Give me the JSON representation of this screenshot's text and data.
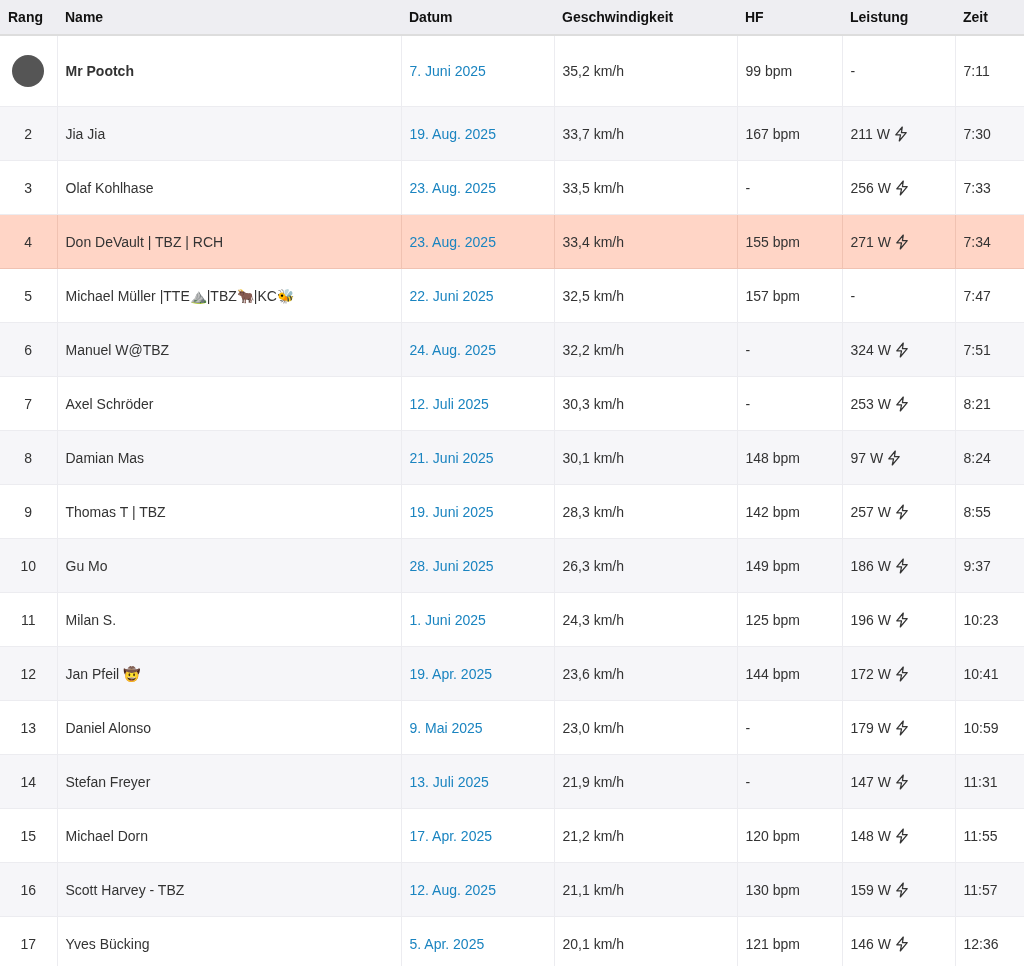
{
  "table": {
    "columns": [
      "Rang",
      "Name",
      "Datum",
      "Geschwindigkeit",
      "HF",
      "Leistung",
      "Zeit"
    ],
    "rows": [
      {
        "kind": "leader",
        "name": "Mr Pootch",
        "date": "7. Juni 2025",
        "speed": "35,2 km/h",
        "hf": "99 bpm",
        "power": "-",
        "power_icon": false,
        "time": "7:11",
        "selected": false
      },
      {
        "kind": "ranked",
        "rank": "2",
        "name": "Jia Jia",
        "date": "19. Aug. 2025",
        "speed": "33,7 km/h",
        "hf": "167 bpm",
        "power": "211 W",
        "power_icon": true,
        "time": "7:30",
        "selected": false
      },
      {
        "kind": "ranked",
        "rank": "3",
        "name": "Olaf Kohlhase",
        "date": "23. Aug. 2025",
        "speed": "33,5 km/h",
        "hf": "-",
        "power": "256 W",
        "power_icon": true,
        "time": "7:33",
        "selected": false
      },
      {
        "kind": "ranked",
        "rank": "4",
        "name": "Don DeVault | TBZ | RCH",
        "date": "23. Aug. 2025",
        "speed": "33,4 km/h",
        "hf": "155 bpm",
        "power": "271 W",
        "power_icon": true,
        "time": "7:34",
        "selected": true
      },
      {
        "kind": "ranked",
        "rank": "5",
        "name": "Michael Müller |TTE⛰️|TBZ🐂|KC🐝",
        "date": "22. Juni 2025",
        "speed": "32,5 km/h",
        "hf": "157 bpm",
        "power": "-",
        "power_icon": false,
        "time": "7:47",
        "selected": false
      },
      {
        "kind": "ranked",
        "rank": "6",
        "name": "Manuel W@TBZ",
        "date": "24. Aug. 2025",
        "speed": "32,2 km/h",
        "hf": "-",
        "power": "324 W",
        "power_icon": true,
        "time": "7:51",
        "selected": false
      },
      {
        "kind": "ranked",
        "rank": "7",
        "name": "Axel Schröder",
        "date": "12. Juli 2025",
        "speed": "30,3 km/h",
        "hf": "-",
        "power": "253 W",
        "power_icon": true,
        "time": "8:21",
        "selected": false
      },
      {
        "kind": "ranked",
        "rank": "8",
        "name": "Damian Mas",
        "date": "21. Juni 2025",
        "speed": "30,1 km/h",
        "hf": "148 bpm",
        "power": "97 W",
        "power_icon": true,
        "time": "8:24",
        "selected": false
      },
      {
        "kind": "ranked",
        "rank": "9",
        "name": "Thomas T | TBZ",
        "date": "19. Juni 2025",
        "speed": "28,3 km/h",
        "hf": "142 bpm",
        "power": "257 W",
        "power_icon": true,
        "time": "8:55",
        "selected": false
      },
      {
        "kind": "ranked",
        "rank": "10",
        "name": "Gu Mo",
        "date": "28. Juni 2025",
        "speed": "26,3 km/h",
        "hf": "149 bpm",
        "power": "186 W",
        "power_icon": true,
        "time": "9:37",
        "selected": false
      },
      {
        "kind": "ranked",
        "rank": "11",
        "name": "Milan S.",
        "date": "1. Juni 2025",
        "speed": "24,3 km/h",
        "hf": "125 bpm",
        "power": "196 W",
        "power_icon": true,
        "time": "10:23",
        "selected": false
      },
      {
        "kind": "ranked",
        "rank": "12",
        "name": "Jan Pfeil 🤠",
        "date": "19. Apr. 2025",
        "speed": "23,6 km/h",
        "hf": "144 bpm",
        "power": "172 W",
        "power_icon": true,
        "time": "10:41",
        "selected": false
      },
      {
        "kind": "ranked",
        "rank": "13",
        "name": "Daniel Alonso",
        "date": "9. Mai 2025",
        "speed": "23,0 km/h",
        "hf": "-",
        "power": "179 W",
        "power_icon": true,
        "time": "10:59",
        "selected": false
      },
      {
        "kind": "ranked",
        "rank": "14",
        "name": "Stefan Freyer",
        "date": "13. Juli 2025",
        "speed": "21,9 km/h",
        "hf": "-",
        "power": "147 W",
        "power_icon": true,
        "time": "11:31",
        "selected": false
      },
      {
        "kind": "ranked",
        "rank": "15",
        "name": "Michael Dorn",
        "date": "17. Apr. 2025",
        "speed": "21,2 km/h",
        "hf": "120 bpm",
        "power": "148 W",
        "power_icon": true,
        "time": "11:55",
        "selected": false
      },
      {
        "kind": "ranked",
        "rank": "16",
        "name": "Scott Harvey - TBZ",
        "date": "12. Aug. 2025",
        "speed": "21,1 km/h",
        "hf": "130 bpm",
        "power": "159 W",
        "power_icon": true,
        "time": "11:57",
        "selected": false
      },
      {
        "kind": "ranked",
        "rank": "17",
        "name": "Yves Bücking",
        "date": "5. Apr. 2025",
        "speed": "20,1 km/h",
        "hf": "121 bpm",
        "power": "146 W",
        "power_icon": true,
        "time": "12:36",
        "selected": false
      }
    ]
  }
}
